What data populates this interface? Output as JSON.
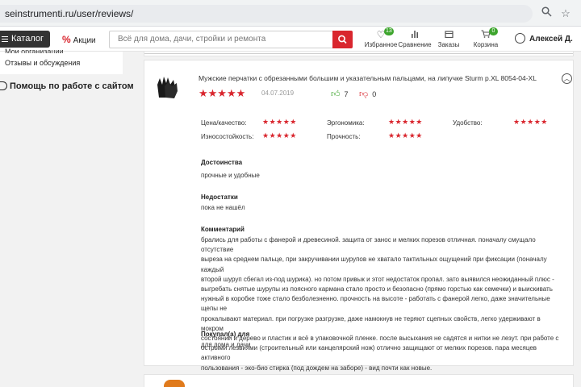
{
  "browser": {
    "url": "seinstrumenti.ru/user/reviews/",
    "icons": [
      "zoom-icon",
      "star-bookmark-icon"
    ]
  },
  "header": {
    "catalog_label": "Каталог",
    "promo_label": "Акции",
    "promo_icon": "%",
    "search_placeholder": "Всё для дома, дачи, стройки и ремонта",
    "nav": [
      {
        "label": "Избранное",
        "icon": "heart-icon",
        "badge": "13"
      },
      {
        "label": "Сравнение",
        "icon": "chart-icon"
      },
      {
        "label": "Заказы",
        "icon": "box-icon"
      },
      {
        "label": "Корзина",
        "icon": "cart-icon",
        "badge": "0"
      }
    ],
    "user_name": "Алексей Д.",
    "accent_color": "#d9262e",
    "badge_color": "#3da52d"
  },
  "sidebar": {
    "cut_item": "Мои организации",
    "active_item": "Отзывы и обсуждения",
    "help_label": "Помощь по работе с сайтом"
  },
  "review": {
    "product_title": "Мужские перчатки с обрезанными большим и указательным пальцами, на липучке Sturm р.XL 8054-04-XL",
    "stars": "★★★★★",
    "date": "04.07.2019",
    "likes": "7",
    "dislikes": "0",
    "ratings": [
      {
        "label": "Цена/качество:",
        "stars": "★★★★★"
      },
      {
        "label": "Эргономика:",
        "stars": "★★★★★"
      },
      {
        "label": "Удобство:",
        "stars": "★★★★★"
      },
      {
        "label": "Износостойкость:",
        "stars": "★★★★★"
      },
      {
        "label": "Прочность:",
        "stars": "★★★★★"
      }
    ],
    "pros_title": "Достоинства",
    "pros_text": "прочные и удобные",
    "cons_title": "Недостатки",
    "cons_text": "пока не нашёл",
    "comment_title": "Комментарий",
    "comment_lines": [
      "брались для работы с фанерой и древесиной. защита от занос и мелких порезов отличная. поначалу смущало отсутствие",
      "выреза на среднем пальце, при закручивании шурупов не хватало тактильных ощущений при фиксации (поначалу каждый",
      "второй шуруп сбегал из-под шурика). но потом привык и этот недостаток пропал. зато выявился неожиданный плюс -",
      "выгребать снятые шурупы из поясного кармана стало просто и безопасно (прямо горстью как семечки) и выискивать",
      "нужный в коробке тоже стало безболезненно. прочность на высоте - работать с фанерой легко, даже значительные щепы не",
      "прокалывают материал. при погрузке разгрузке, даже намокнув не теряют сцепных свойств, легко удерживают в мокром",
      "состоянии и дерево и пластик и всё в упаковочной пленке. после высыхания не садятся и нитки не лезут. при работе с",
      "острыми лезвиями (строительный или канцелярский нож) отлично защищают от мелких порезов. пара месяцев активного",
      "пользования - эко-био стирка (под дождем на заборе) - вид почти как новые."
    ],
    "bought_for_title": "Покупал(а) для",
    "bought_for_text": "для дома и дачи"
  }
}
